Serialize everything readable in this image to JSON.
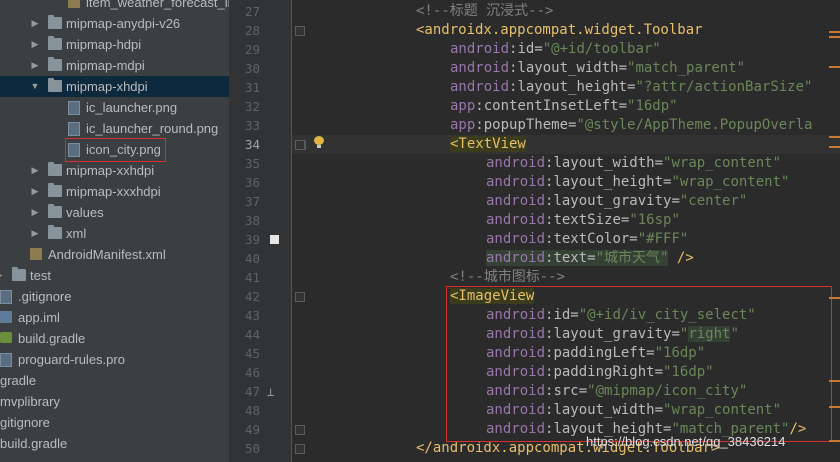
{
  "tree": {
    "items": [
      {
        "label": "item_weather_forecast_lis",
        "indent": 68,
        "type": "xml",
        "arrow": ""
      },
      {
        "label": "mipmap-anydpi-v26",
        "indent": 48,
        "type": "folder",
        "arrow": "▶"
      },
      {
        "label": "mipmap-hdpi",
        "indent": 48,
        "type": "folder",
        "arrow": "▶"
      },
      {
        "label": "mipmap-mdpi",
        "indent": 48,
        "type": "folder",
        "arrow": "▶"
      },
      {
        "label": "mipmap-xhdpi",
        "indent": 48,
        "type": "folder",
        "arrow": "▼"
      },
      {
        "label": "ic_launcher.png",
        "indent": 68,
        "type": "file",
        "arrow": ""
      },
      {
        "label": "ic_launcher_round.png",
        "indent": 68,
        "type": "file",
        "arrow": ""
      },
      {
        "label": "icon_city.png",
        "indent": 68,
        "type": "file",
        "arrow": ""
      },
      {
        "label": "mipmap-xxhdpi",
        "indent": 48,
        "type": "folder",
        "arrow": "▶"
      },
      {
        "label": "mipmap-xxxhdpi",
        "indent": 48,
        "type": "folder",
        "arrow": "▶"
      },
      {
        "label": "values",
        "indent": 48,
        "type": "folder",
        "arrow": "▶"
      },
      {
        "label": "xml",
        "indent": 48,
        "type": "folder",
        "arrow": "▶"
      },
      {
        "label": "AndroidManifest.xml",
        "indent": 30,
        "type": "xml",
        "arrow": ""
      },
      {
        "label": "test",
        "indent": 12,
        "type": "folder",
        "arrow": "▶"
      },
      {
        "label": ".gitignore",
        "indent": 0,
        "type": "file",
        "arrow": ""
      },
      {
        "label": "app.iml",
        "indent": 0,
        "type": "iml",
        "arrow": ""
      },
      {
        "label": "build.gradle",
        "indent": 0,
        "type": "gradle",
        "arrow": ""
      },
      {
        "label": "proguard-rules.pro",
        "indent": 0,
        "type": "file",
        "arrow": ""
      },
      {
        "label": "gradle",
        "indent": -12,
        "type": "none",
        "arrow": ""
      },
      {
        "label": "mvplibrary",
        "indent": -12,
        "type": "none",
        "arrow": ""
      },
      {
        "label": "gitignore",
        "indent": -12,
        "type": "none",
        "arrow": ""
      },
      {
        "label": "build.gradle",
        "indent": -12,
        "type": "none",
        "arrow": ""
      }
    ],
    "selected_item": "mipmap-xhdpi",
    "highlighted_item": "icon_city.png"
  },
  "editor": {
    "current_line": 34,
    "lines": [
      {
        "n": 27,
        "segs": [
          [
            "c",
            "<!--标题 沉浸式-->"
          ]
        ],
        "ind": 0
      },
      {
        "n": 28,
        "segs": [
          [
            "tag",
            "<androidx.appcompat.widget.Toolbar"
          ]
        ],
        "ind": 0
      },
      {
        "n": 29,
        "segs": [
          [
            "ns",
            "android"
          ],
          [
            "at",
            ":id="
          ],
          [
            "str",
            "\"@+id/toolbar\""
          ]
        ],
        "ind": 1
      },
      {
        "n": 30,
        "segs": [
          [
            "ns",
            "android"
          ],
          [
            "at",
            ":layout_width="
          ],
          [
            "str",
            "\"match_parent\""
          ]
        ],
        "ind": 1
      },
      {
        "n": 31,
        "segs": [
          [
            "ns",
            "android"
          ],
          [
            "at",
            ":layout_height="
          ],
          [
            "str",
            "\"?attr/actionBarSize\""
          ]
        ],
        "ind": 1
      },
      {
        "n": 32,
        "segs": [
          [
            "ns",
            "app"
          ],
          [
            "at",
            ":contentInsetLeft="
          ],
          [
            "str",
            "\"16dp\""
          ]
        ],
        "ind": 1
      },
      {
        "n": 33,
        "segs": [
          [
            "ns",
            "app"
          ],
          [
            "at",
            ":popupTheme="
          ],
          [
            "str",
            "\"@style/AppTheme.PopupOverla"
          ]
        ],
        "ind": 1
      },
      {
        "n": 34,
        "segs": [
          [
            "tagb",
            "<TextView"
          ]
        ],
        "ind": 1
      },
      {
        "n": 35,
        "segs": [
          [
            "ns",
            "android"
          ],
          [
            "at",
            ":layout_width="
          ],
          [
            "str",
            "\"wrap_content\""
          ]
        ],
        "ind": 2
      },
      {
        "n": 36,
        "segs": [
          [
            "ns",
            "android"
          ],
          [
            "at",
            ":layout_height="
          ],
          [
            "str",
            "\"wrap_content\""
          ]
        ],
        "ind": 2
      },
      {
        "n": 37,
        "segs": [
          [
            "ns",
            "android"
          ],
          [
            "at",
            ":layout_gravity="
          ],
          [
            "str",
            "\"center\""
          ]
        ],
        "ind": 2
      },
      {
        "n": 38,
        "segs": [
          [
            "ns",
            "android"
          ],
          [
            "at",
            ":textSize="
          ],
          [
            "str",
            "\"16sp\""
          ]
        ],
        "ind": 2
      },
      {
        "n": 39,
        "segs": [
          [
            "ns",
            "android"
          ],
          [
            "at",
            ":textColor="
          ],
          [
            "str",
            "\"#FFF\""
          ]
        ],
        "ind": 2
      },
      {
        "n": 40,
        "segs": [
          [
            "nsh",
            "android"
          ],
          [
            "ath",
            ":text="
          ],
          [
            "strh",
            "\"城市天气\""
          ],
          [
            "pun",
            " "
          ],
          [
            "tag",
            "/>"
          ]
        ],
        "ind": 2
      },
      {
        "n": 41,
        "segs": [
          [
            "c",
            "<!--城市图标-->"
          ]
        ],
        "ind": 1
      },
      {
        "n": 42,
        "segs": [
          [
            "tagb",
            "<ImageView"
          ]
        ],
        "ind": 1
      },
      {
        "n": 43,
        "segs": [
          [
            "ns",
            "android"
          ],
          [
            "at",
            ":id="
          ],
          [
            "str",
            "\"@+id/iv_city_select\""
          ]
        ],
        "ind": 2
      },
      {
        "n": 44,
        "segs": [
          [
            "ns",
            "android"
          ],
          [
            "at",
            ":layout_gravity="
          ],
          [
            "str",
            "\""
          ],
          [
            "strh",
            "right"
          ],
          [
            "str",
            "\""
          ]
        ],
        "ind": 2
      },
      {
        "n": 45,
        "segs": [
          [
            "ns",
            "android"
          ],
          [
            "at",
            ":paddingLeft="
          ],
          [
            "str",
            "\"16dp\""
          ]
        ],
        "ind": 2
      },
      {
        "n": 46,
        "segs": [
          [
            "ns",
            "android"
          ],
          [
            "at",
            ":paddingRight="
          ],
          [
            "str",
            "\"16dp\""
          ]
        ],
        "ind": 2
      },
      {
        "n": 47,
        "segs": [
          [
            "ns",
            "android"
          ],
          [
            "at",
            ":src="
          ],
          [
            "str",
            "\"@mipmap/icon_city\""
          ]
        ],
        "ind": 2
      },
      {
        "n": 48,
        "segs": [
          [
            "ns",
            "android"
          ],
          [
            "at",
            ":layout_width="
          ],
          [
            "str",
            "\"wrap_content\""
          ]
        ],
        "ind": 2
      },
      {
        "n": 49,
        "segs": [
          [
            "ns",
            "android"
          ],
          [
            "at",
            ":layout_height="
          ],
          [
            "str",
            "\"match_parent\""
          ],
          [
            "tag",
            "/>"
          ]
        ],
        "ind": 2
      },
      {
        "n": 50,
        "segs": [
          [
            "tag",
            "</androidx.appcompat.widget.Toolbar>"
          ]
        ],
        "ind": 0
      }
    ]
  },
  "watermark": "https://blog.csdn.net/qq_38436214",
  "colors": {
    "sidebar_bg": "#3c3f41",
    "editor_bg": "#2b2b2b",
    "highlight_border": "#d42e2e",
    "tag": "#e8bf6a",
    "namespace": "#9876aa",
    "string": "#6a8759",
    "comment": "#808080"
  }
}
